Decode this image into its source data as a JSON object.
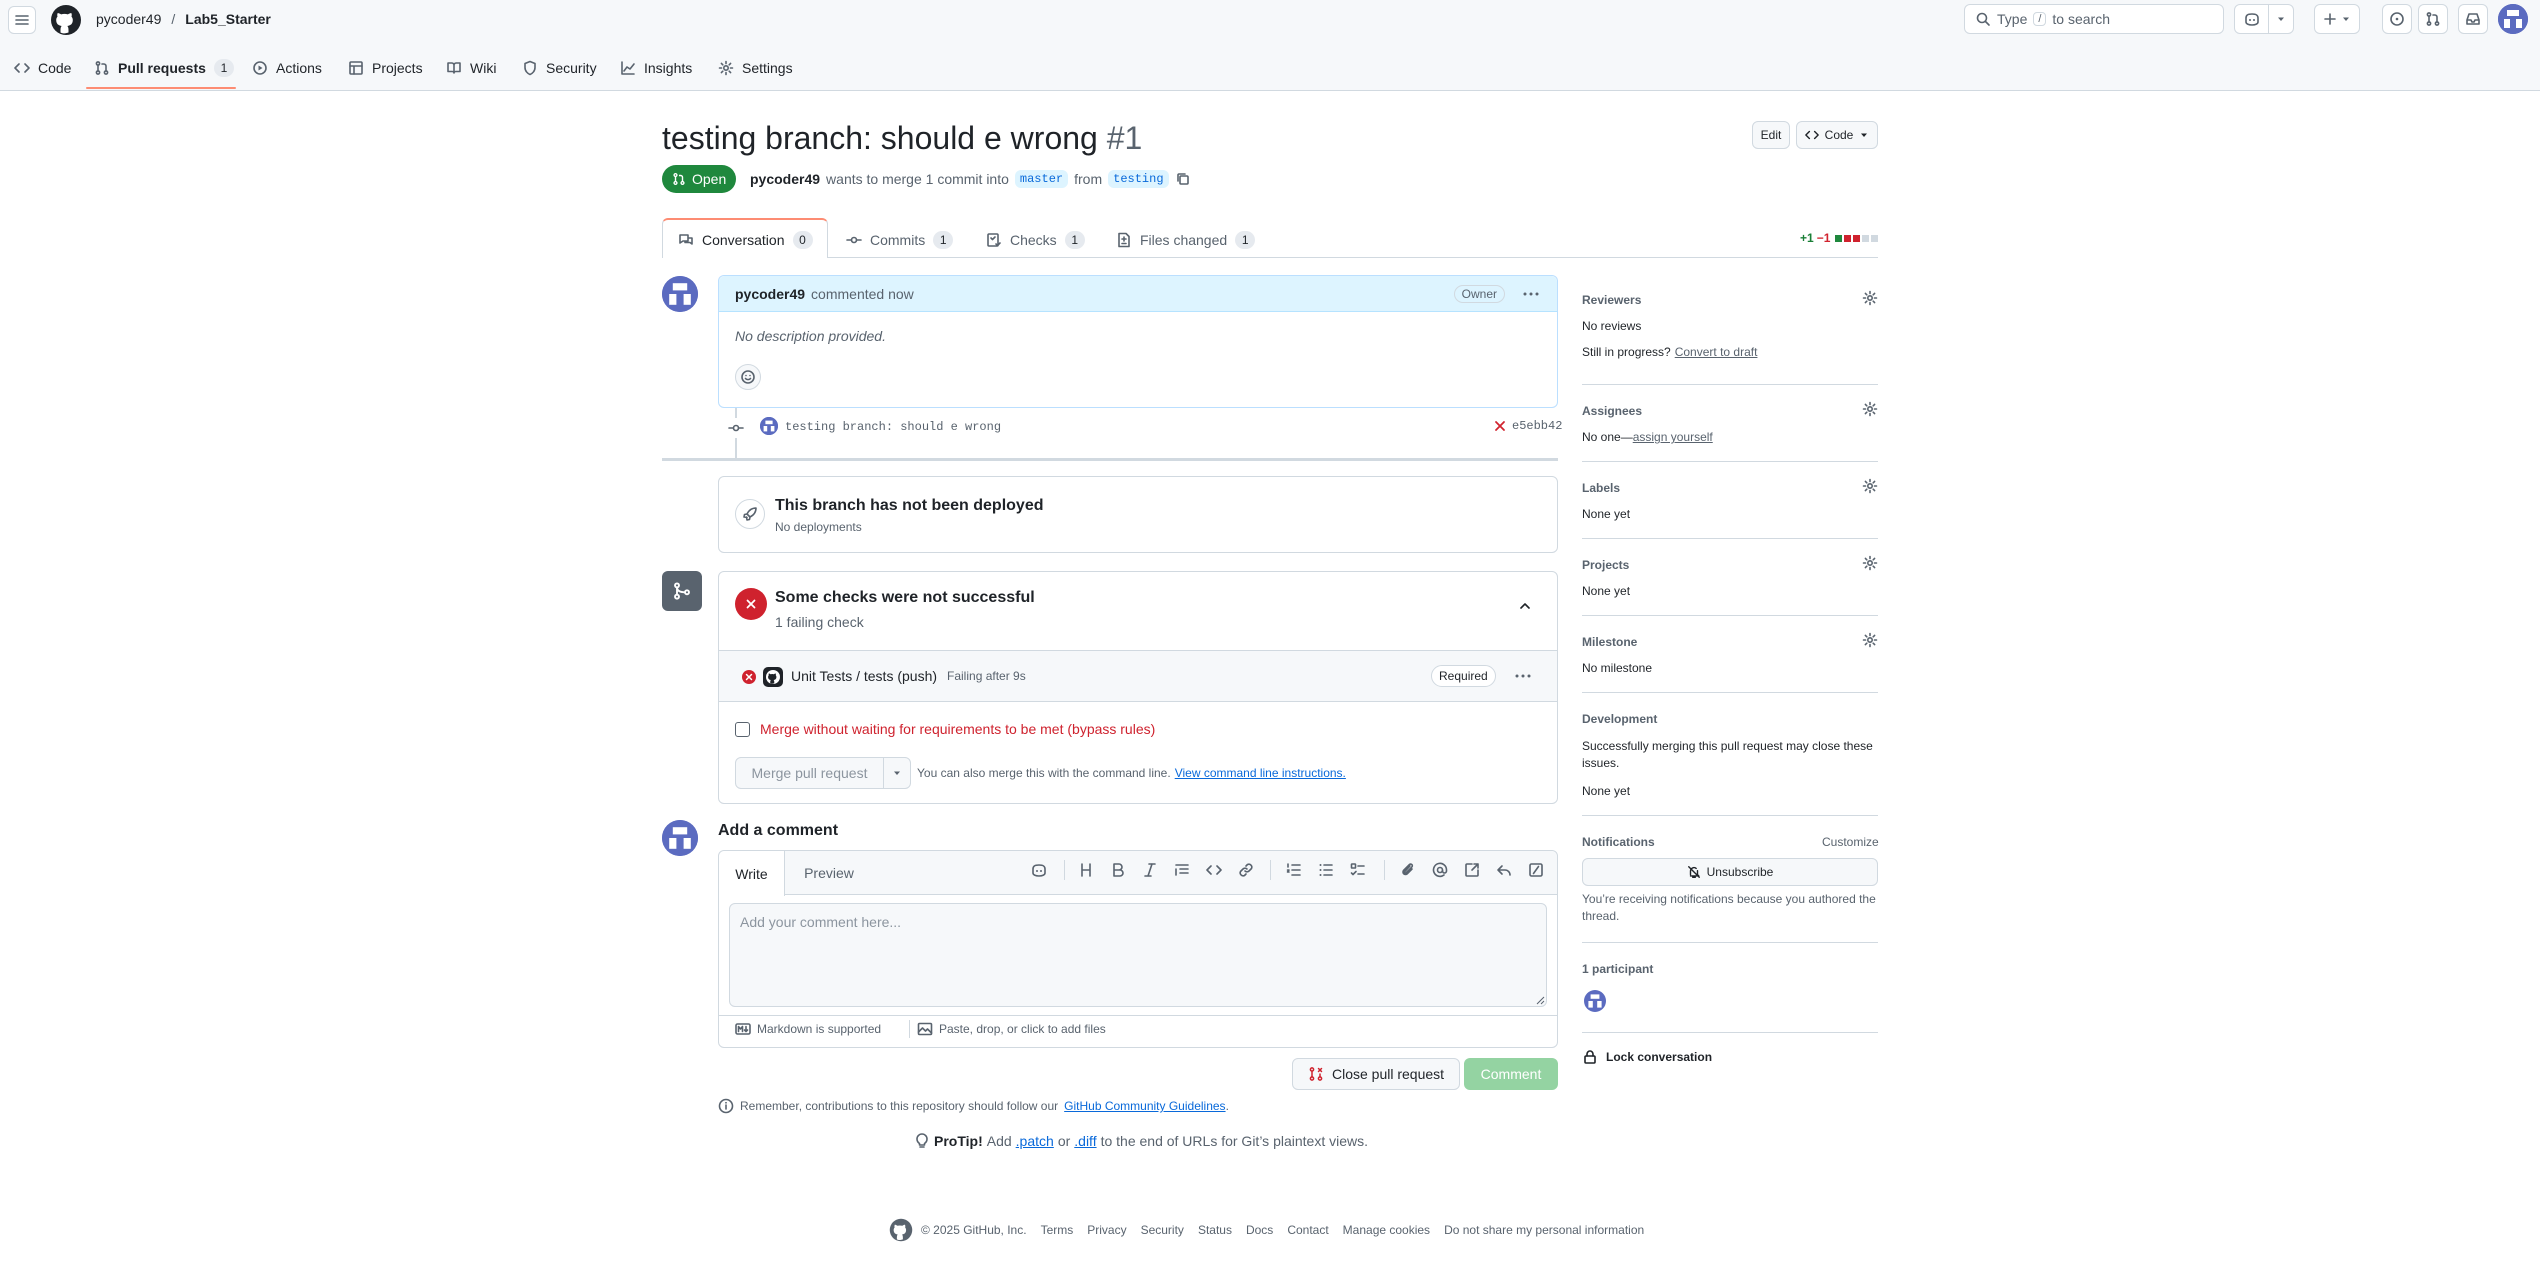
{
  "header": {
    "owner": "pycoder49",
    "separator": "/",
    "repo": "Lab5_Starter",
    "search_prefix": "Type",
    "search_key": "/",
    "search_suffix": "to search"
  },
  "repo_nav": {
    "code": "Code",
    "pull_requests": "Pull requests",
    "pull_requests_count": "1",
    "actions": "Actions",
    "projects": "Projects",
    "wiki": "Wiki",
    "security": "Security",
    "insights": "Insights",
    "settings": "Settings"
  },
  "pr": {
    "title": "testing branch: should e wrong",
    "number": "#1",
    "edit_label": "Edit",
    "code_label": "Code",
    "state": "Open",
    "author": "pycoder49",
    "merge_text_1": "wants to merge 1 commit into",
    "base_branch": "master",
    "merge_text_2": "from",
    "head_branch": "testing"
  },
  "pr_tabs": {
    "conversation": "Conversation",
    "conversation_count": "0",
    "commits": "Commits",
    "commits_count": "1",
    "checks": "Checks",
    "checks_count": "1",
    "files_changed": "Files changed",
    "files_changed_count": "1",
    "additions": "+1",
    "deletions": "−1"
  },
  "comment": {
    "author": "pycoder49",
    "time": "commented now",
    "role": "Owner",
    "body": "No description provided."
  },
  "commit": {
    "message": "testing branch: should e wrong",
    "sha": "e5ebb42"
  },
  "deployment": {
    "title": "This branch has not been deployed",
    "subtitle": "No deployments"
  },
  "checks": {
    "title": "Some checks were not successful",
    "subtitle": "1 failing check",
    "check_name": "Unit Tests / tests (push)",
    "check_status": "Failing after 9s",
    "required": "Required",
    "bypass_label": "Merge without waiting for requirements to be met (bypass rules)",
    "merge_button": "Merge pull request",
    "cli_text": "You can also merge this with the command line.",
    "cli_link": "View command line instructions."
  },
  "new_comment": {
    "heading": "Add a comment",
    "tab_write": "Write",
    "tab_preview": "Preview",
    "placeholder": "Add your comment here...",
    "markdown_note": "Markdown is supported",
    "attach_note": "Paste, drop, or click to add files",
    "close_button": "Close pull request",
    "comment_button": "Comment"
  },
  "footer_notes": {
    "guidelines_text": "Remember, contributions to this repository should follow our",
    "guidelines_link": "GitHub Community Guidelines",
    "period": ".",
    "protip_label": "ProTip!",
    "protip_text1": "Add",
    "protip_patch": ".patch",
    "protip_or": "or",
    "protip_diff": ".diff",
    "protip_text2": "to the end of URLs for Git’s plaintext views."
  },
  "sidebar": {
    "reviewers_title": "Reviewers",
    "reviewers_value": "No reviews",
    "in_progress": "Still in progress?",
    "convert_draft": "Convert to draft",
    "assignees_title": "Assignees",
    "assignees_value": "No one—",
    "assign_yourself": "assign yourself",
    "labels_title": "Labels",
    "labels_value": "None yet",
    "projects_title": "Projects",
    "projects_value": "None yet",
    "milestone_title": "Milestone",
    "milestone_value": "No milestone",
    "development_title": "Development",
    "development_text": "Successfully merging this pull request may close these issues.",
    "development_value": "None yet",
    "notifications_title": "Notifications",
    "customize": "Customize",
    "unsubscribe": "Unsubscribe",
    "notifications_text": "You’re receiving notifications because you authored the thread.",
    "participants": "1 participant",
    "lock": "Lock conversation"
  },
  "footer": {
    "copyright": "© 2025 GitHub, Inc.",
    "links": [
      "Terms",
      "Privacy",
      "Security",
      "Status",
      "Docs",
      "Contact",
      "Manage cookies",
      "Do not share my personal information"
    ]
  },
  "colors": {
    "open_green": "#1f883d",
    "link_blue": "#0969da",
    "danger_red": "#cf222e",
    "tab_underline": "#fd8c73",
    "comment_header_bg": "#ddf4ff",
    "avatar_purple": "#5b6bc0"
  }
}
